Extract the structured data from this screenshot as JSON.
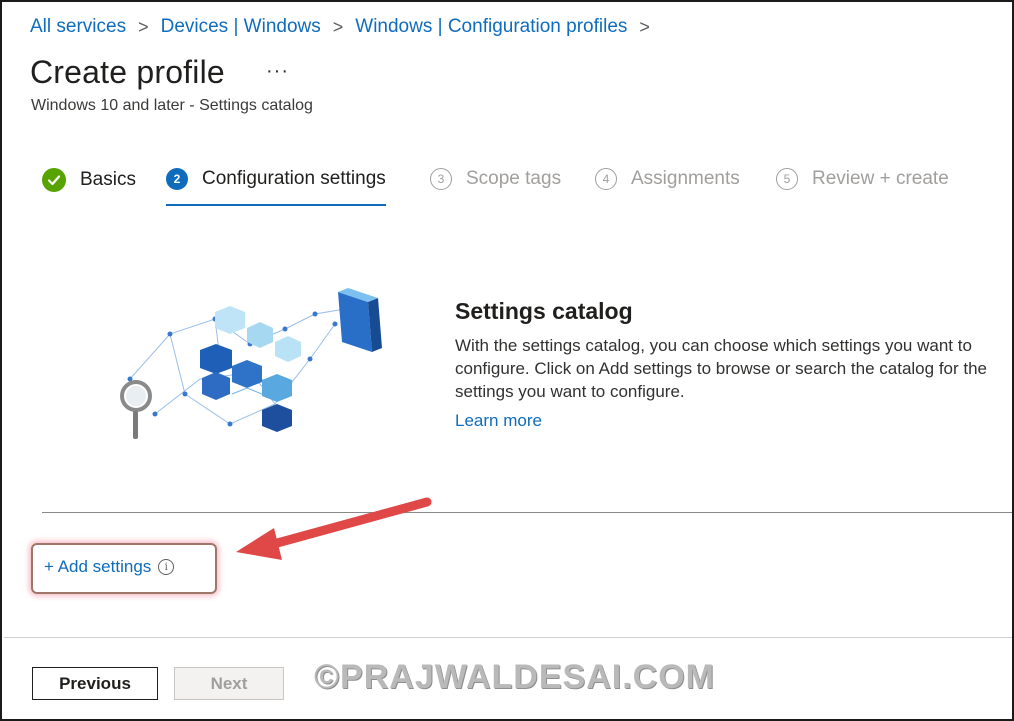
{
  "breadcrumb": {
    "items": [
      "All services",
      "Devices | Windows",
      "Windows | Configuration profiles"
    ],
    "separator": ">"
  },
  "header": {
    "title": "Create profile",
    "more": "···",
    "subtitle": "Windows 10 and later - Settings catalog"
  },
  "steps": [
    {
      "number": "✓",
      "label": "Basics",
      "state": "done"
    },
    {
      "number": "2",
      "label": "Configuration settings",
      "state": "active"
    },
    {
      "number": "3",
      "label": "Scope tags",
      "state": "pending"
    },
    {
      "number": "4",
      "label": "Assignments",
      "state": "pending"
    },
    {
      "number": "5",
      "label": "Review + create",
      "state": "pending"
    }
  ],
  "catalog": {
    "title": "Settings catalog",
    "description": "With the settings catalog, you can choose which settings you want to configure. Click on Add settings to browse or search the catalog for the settings you want to configure.",
    "learn_more": "Learn more",
    "illustration_icon": "settings-catalog-cubes-illustration"
  },
  "add_settings": {
    "label": "+ Add settings",
    "info_icon": "i"
  },
  "footer": {
    "previous": "Previous",
    "next": "Next"
  },
  "watermark": "©PRAJWALDESAI.COM",
  "colors": {
    "link": "#0f6cbd",
    "done_check": "#57a300",
    "active_step": "#0f6cbd",
    "annotation_arrow": "#e04848",
    "highlight_border": "#a0766a"
  }
}
